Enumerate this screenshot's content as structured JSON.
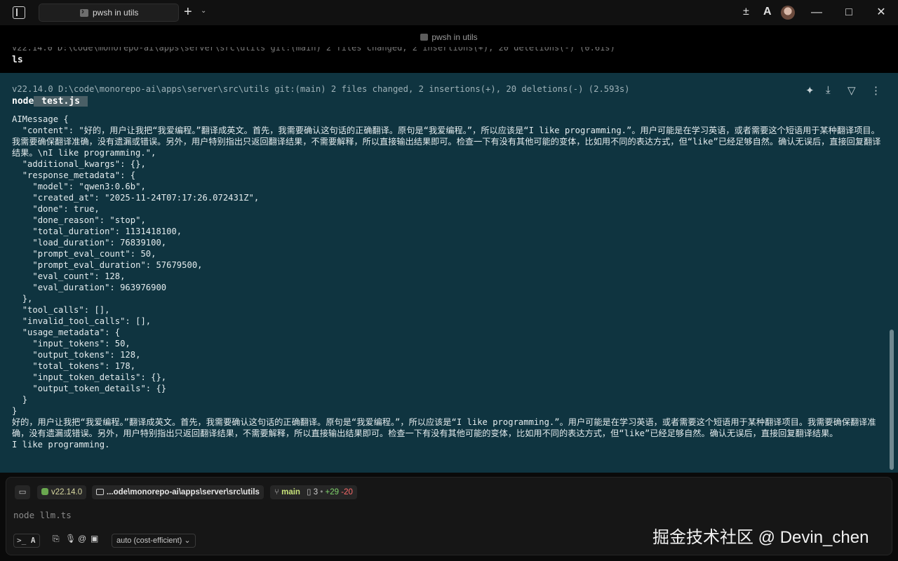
{
  "window": {
    "tab_title": "pwsh in utils",
    "new_tab_glyph": "+",
    "dropdown_glyph": "⌄",
    "plus_minus_glyph": "±",
    "logo_glyph": "A",
    "minimize_glyph": "—",
    "maximize_glyph": "□",
    "close_glyph": "✕"
  },
  "terminal": {
    "pane_title": "pwsh in utils",
    "previous": {
      "status": "v22.14.0 D:\\code\\monorepo-ai\\apps\\server\\src\\utils git:(main)  2 files changed, 2 insertions(+), 20 deletions(-)  (0.61s)",
      "command": "ls"
    },
    "active": {
      "status": "v22.14.0 D:\\code\\monorepo-ai\\apps\\server\\src\\utils git:(main)  2 files changed, 2 insertions(+), 20 deletions(-)  (2.593s)",
      "command_prefix": "node",
      "command_arg": " test.js ",
      "actions": [
        "sparkle-icon",
        "download-icon",
        "filter-icon",
        "more-icon"
      ],
      "output": "AIMessage {\n  \"content\": \"好的，用户让我把“我爱编程。”翻译成英文。首先，我需要确认这句话的正确翻译。原句是“我爱编程。”，所以应该是“I like programming.”。用户可能是在学习英语，或者需要这个短语用于某种翻译项目。我需要确保翻译准确，没有遗漏或错误。另外，用户特别指出只返回翻译结果，不需要解释，所以直接输出结果即可。检查一下有没有其他可能的变体，比如用不同的表达方式，但“like”已经足够自然。确认无误后，直接回复翻译结果。\\nI like programming.\",\n  \"additional_kwargs\": {},\n  \"response_metadata\": {\n    \"model\": \"qwen3:0.6b\",\n    \"created_at\": \"2025-11-24T07:17:26.072431Z\",\n    \"done\": true,\n    \"done_reason\": \"stop\",\n    \"total_duration\": 1131418100,\n    \"load_duration\": 76839100,\n    \"prompt_eval_count\": 50,\n    \"prompt_eval_duration\": 57679500,\n    \"eval_count\": 128,\n    \"eval_duration\": 963976900\n  },\n  \"tool_calls\": [],\n  \"invalid_tool_calls\": [],\n  \"usage_metadata\": {\n    \"input_tokens\": 50,\n    \"output_tokens\": 128,\n    \"total_tokens\": 178,\n    \"input_token_details\": {},\n    \"output_token_details\": {}\n  }\n}\n好的，用户让我把“我爱编程。”翻译成英文。首先，我需要确认这句话的正确翻译。原句是“我爱编程。”，所以应该是“I like programming.”。用户可能是在学习英语，或者需要这个短语用于某种翻译项目。我需要确保翻译准确，没有遗漏或错误。另外，用户特别指出只返回翻译结果，不需要解释，所以直接输出结果即可。检查一下有没有其他可能的变体，比如用不同的表达方式，但“like”已经足够自然。确认无误后，直接回复翻译结果。\nI like programming."
    }
  },
  "input_bar": {
    "node_version": "v22.14.0",
    "path": "...ode\\monorepo-ai\\apps\\server\\src\\utils",
    "branch": "main",
    "files_changed": "3",
    "separator": "•",
    "insertions": "+29",
    "deletions": "-20",
    "placeholder": "node llm.ts",
    "model_select": "auto (cost-efficient)",
    "colors": {
      "insertions": "#7fd36b",
      "deletions": "#ff6b6b",
      "branch": "#c8e37a",
      "accent_bg": "#0f3440"
    }
  },
  "watermark": "掘金技术社区 @ Devin_chen"
}
